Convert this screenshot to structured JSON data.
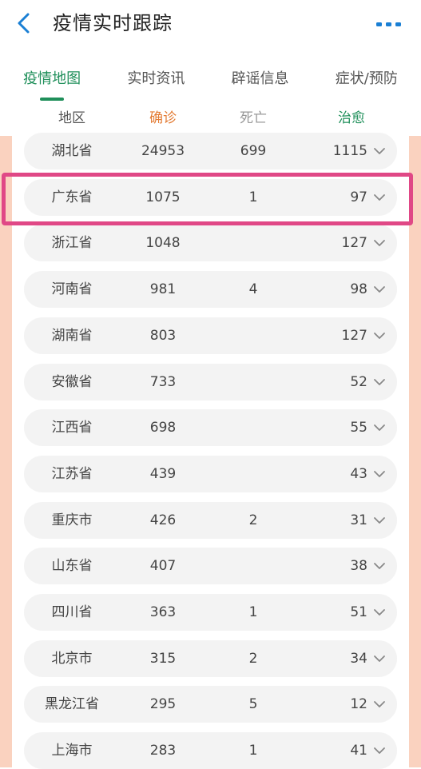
{
  "header": {
    "title": "疫情实时跟踪"
  },
  "tabs": [
    {
      "label": "疫情地图",
      "active": true
    },
    {
      "label": "实时资讯",
      "active": false
    },
    {
      "label": "辟谣信息",
      "active": false
    },
    {
      "label": "症状/预防",
      "active": false
    }
  ],
  "table": {
    "headers": {
      "region": "地区",
      "confirmed": "确诊",
      "deaths": "死亡",
      "cured": "治愈"
    },
    "rows": [
      {
        "region": "湖北省",
        "confirmed": "24953",
        "deaths": "699",
        "cured": "1115"
      },
      {
        "region": "广东省",
        "confirmed": "1075",
        "deaths": "1",
        "cured": "97"
      },
      {
        "region": "浙江省",
        "confirmed": "1048",
        "deaths": "",
        "cured": "127"
      },
      {
        "region": "河南省",
        "confirmed": "981",
        "deaths": "4",
        "cured": "98"
      },
      {
        "region": "湖南省",
        "confirmed": "803",
        "deaths": "",
        "cured": "127"
      },
      {
        "region": "安徽省",
        "confirmed": "733",
        "deaths": "",
        "cured": "52"
      },
      {
        "region": "江西省",
        "confirmed": "698",
        "deaths": "",
        "cured": "55"
      },
      {
        "region": "江苏省",
        "confirmed": "439",
        "deaths": "",
        "cured": "43"
      },
      {
        "region": "重庆市",
        "confirmed": "426",
        "deaths": "2",
        "cured": "31"
      },
      {
        "region": "山东省",
        "confirmed": "407",
        "deaths": "",
        "cured": "38"
      },
      {
        "region": "四川省",
        "confirmed": "363",
        "deaths": "1",
        "cured": "51"
      },
      {
        "region": "北京市",
        "confirmed": "315",
        "deaths": "2",
        "cured": "34"
      },
      {
        "region": "黑龙江省",
        "confirmed": "295",
        "deaths": "5",
        "cured": "12"
      },
      {
        "region": "上海市",
        "confirmed": "283",
        "deaths": "1",
        "cured": "41"
      }
    ]
  },
  "colors": {
    "accent_green": "#1f8f5a",
    "confirmed_orange": "#e37b33",
    "deaths_gray": "#999999",
    "highlight_pink": "#e04886",
    "side_strip": "#fad2bf"
  },
  "icons": {
    "back": "chevron-left-icon",
    "more": "more-dots-icon",
    "expand": "chevron-down-icon"
  }
}
